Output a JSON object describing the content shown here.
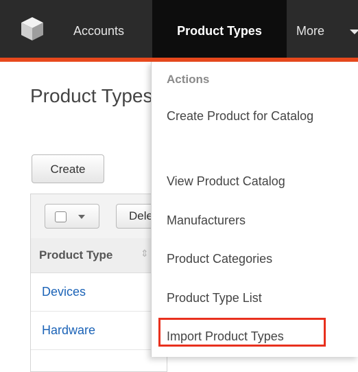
{
  "nav": {
    "items": [
      "Accounts",
      "Product Types",
      "More"
    ],
    "active": "Product Types"
  },
  "page": {
    "title": "Product Types",
    "create_label": "Create",
    "delete_label": "Delete",
    "column_header": "Product Type",
    "rows": [
      "Devices",
      "Hardware"
    ]
  },
  "menu": {
    "section_label": "Actions",
    "items": [
      "Create Product for Catalog",
      "View Product Catalog",
      "Manufacturers",
      "Product Categories",
      "Product Type List",
      "Import Product Types"
    ],
    "highlighted": "Import Product Types"
  },
  "colors": {
    "topbar": "#2b2b2b",
    "accent": "#e8491d",
    "highlight_border": "#e8301d",
    "link": "#1b63b7"
  }
}
